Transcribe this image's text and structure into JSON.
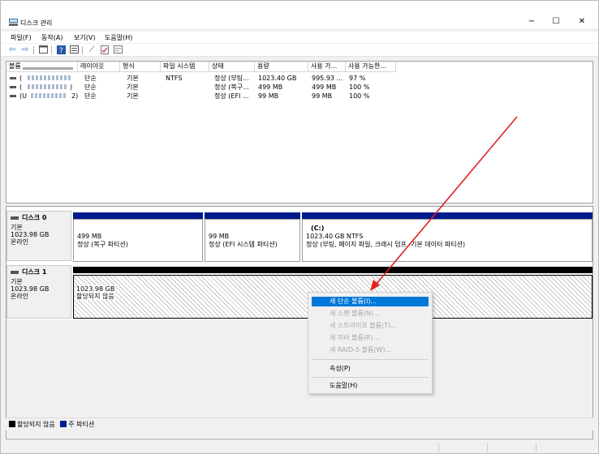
{
  "window": {
    "title": "디스크 관리",
    "minimize": "−",
    "maximize": "☐",
    "close": "✕"
  },
  "menu": [
    "파일(F)",
    "동작(A)",
    "보기(V)",
    "도움말(H)"
  ],
  "toolbar": {
    "icons": [
      "back-icon",
      "forward-icon",
      "properties-icon",
      "help-icon",
      "refresh-icon",
      "connect-icon",
      "check-icon",
      "list-icon"
    ]
  },
  "volume_table": {
    "headers": [
      "볼륨",
      "레이아웃",
      "형식",
      "파일 시스템",
      "상태",
      "용량",
      "사용 가...",
      "사용 가능한..."
    ],
    "rows": [
      {
        "volume": "(",
        "layout": "단순",
        "type": "기본",
        "fs": "NTFS",
        "status": "정상 (부팅...",
        "capacity": "1023.40 GB",
        "free": "995.93 ...",
        "pct": "97 %"
      },
      {
        "volume": "(",
        "suffix": ")",
        "layout": "단순",
        "type": "기본",
        "fs": "",
        "status": "정상 (복구...",
        "capacity": "499 MB",
        "free": "499 MB",
        "pct": "100 %"
      },
      {
        "volume": "(U",
        "suffix": "2)",
        "layout": "단순",
        "type": "기본",
        "fs": "",
        "status": "정상 (EFI ...",
        "capacity": "99 MB",
        "free": "99 MB",
        "pct": "100 %"
      }
    ]
  },
  "disks": [
    {
      "name": "디스크 0",
      "type": "기본",
      "size": "1023.98 GB",
      "state": "온라인",
      "partitions": [
        {
          "title": "",
          "line1": "499 MB",
          "line2": "정상 (복구 파티션)"
        },
        {
          "title": "",
          "line1": "99 MB",
          "line2": "정상 (EFI 시스템 파티션)"
        },
        {
          "title": "(C:)",
          "line1": "1023.40 GB NTFS",
          "line2": "정상 (부팅, 페이지 파일, 크래시 덤프, 기본 데이터 파티션)"
        }
      ]
    },
    {
      "name": "디스크 1",
      "type": "기본",
      "size": "1023.98 GB",
      "state": "온라인",
      "unallocated": {
        "line1": "1023.98 GB",
        "line2": "할당되지 않음"
      }
    }
  ],
  "context_menu": {
    "items": [
      {
        "label": "새 단순 볼륨(I)...",
        "state": "active"
      },
      {
        "label": "새 스팬 볼륨(N)...",
        "state": "disabled"
      },
      {
        "label": "새 스트라이프 볼륨(T)...",
        "state": "disabled"
      },
      {
        "label": "새 미러 볼륨(R)...",
        "state": "disabled"
      },
      {
        "label": "새 RAID-5 볼륨(W)...",
        "state": "disabled"
      },
      {
        "label": "속성(P)",
        "state": "normal"
      },
      {
        "label": "도움말(H)",
        "state": "normal"
      }
    ]
  },
  "legend": [
    {
      "label": "할당되지 않음",
      "color": "#000000"
    },
    {
      "label": "주 파티션",
      "color": "#001b8c"
    }
  ],
  "colors": {
    "partition_band": "#001b8c",
    "unallocated_band": "#000000",
    "selection": "#0078d7",
    "annotation_arrow": "#e02020"
  }
}
